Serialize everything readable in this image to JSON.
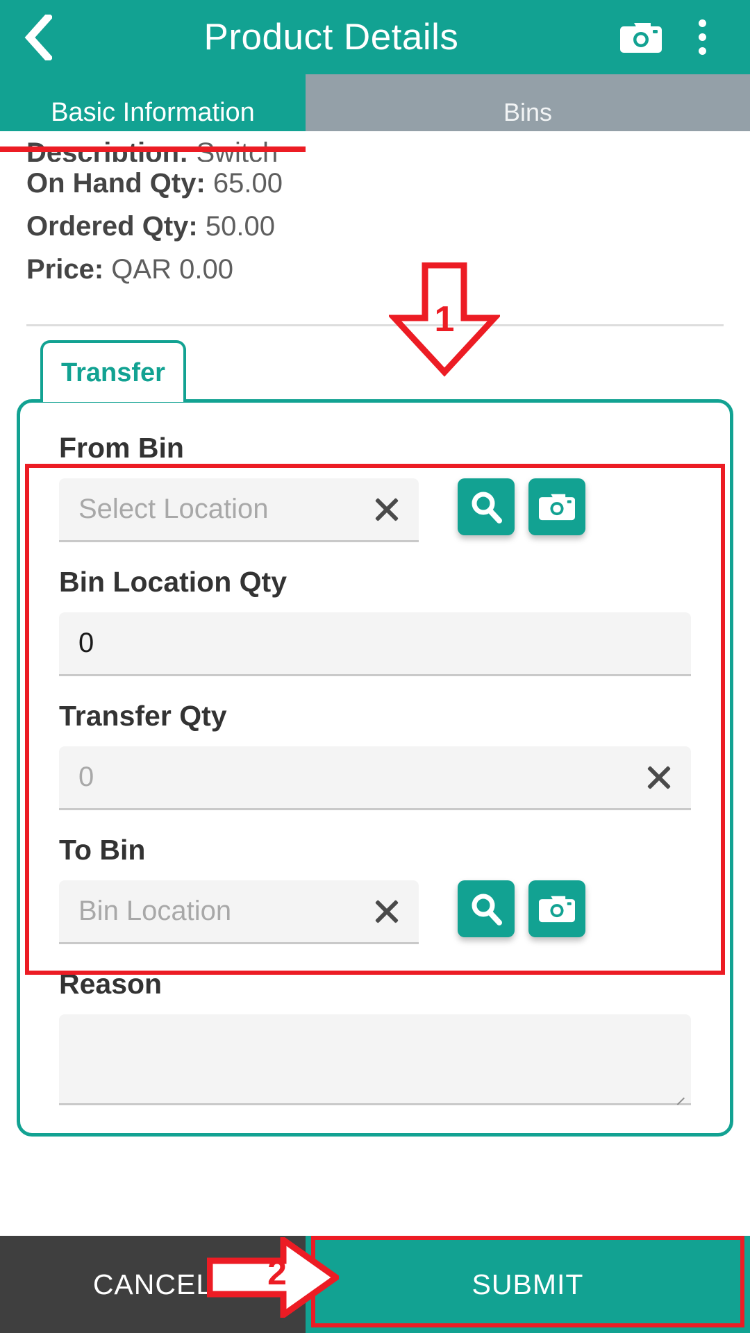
{
  "appbar": {
    "title": "Product Details",
    "back_icon": "back-chevron-icon",
    "camera_icon": "camera-icon",
    "overflow_icon": "kebab-menu-icon"
  },
  "tabs": [
    {
      "label": "Basic Information",
      "active": true
    },
    {
      "label": "Bins",
      "active": false
    }
  ],
  "product_info": [
    {
      "label": "Description:",
      "value": "Switch"
    },
    {
      "label": "On Hand Qty:",
      "value": "65.00"
    },
    {
      "label": "Ordered Qty:",
      "value": "50.00"
    },
    {
      "label": "Price:",
      "value": "QAR 0.00"
    }
  ],
  "section_chip": {
    "label": "Transfer"
  },
  "form": {
    "from_bin": {
      "label": "From Bin",
      "value": "",
      "placeholder": "Select Location",
      "clear_icon": "close-x-icon",
      "search_icon": "search-icon",
      "camera_icon": "camera-icon"
    },
    "bin_location_qty": {
      "label": "Bin Location Qty",
      "value": "0",
      "placeholder": ""
    },
    "transfer_qty": {
      "label": "Transfer Qty",
      "value": "",
      "placeholder": "0",
      "clear_icon": "close-x-icon"
    },
    "to_bin": {
      "label": "To Bin",
      "value": "",
      "placeholder": "Bin Location",
      "clear_icon": "close-x-icon",
      "search_icon": "search-icon",
      "camera_icon": "camera-icon"
    },
    "reason": {
      "label": "Reason",
      "value": "",
      "placeholder": ""
    }
  },
  "bottom_bar": {
    "cancel_label": "CANCEL",
    "submit_label": "SUBMIT"
  },
  "annotations": {
    "step_one": "1",
    "step_two": "2",
    "color": "#EC1C24"
  },
  "colors": {
    "accent_teal": "#12A292",
    "inactive_tab": "#94A0A8",
    "cancel_dark": "#3F3F3F",
    "field_fill": "#F4F4F4",
    "annotation_red": "#EC1C24"
  }
}
